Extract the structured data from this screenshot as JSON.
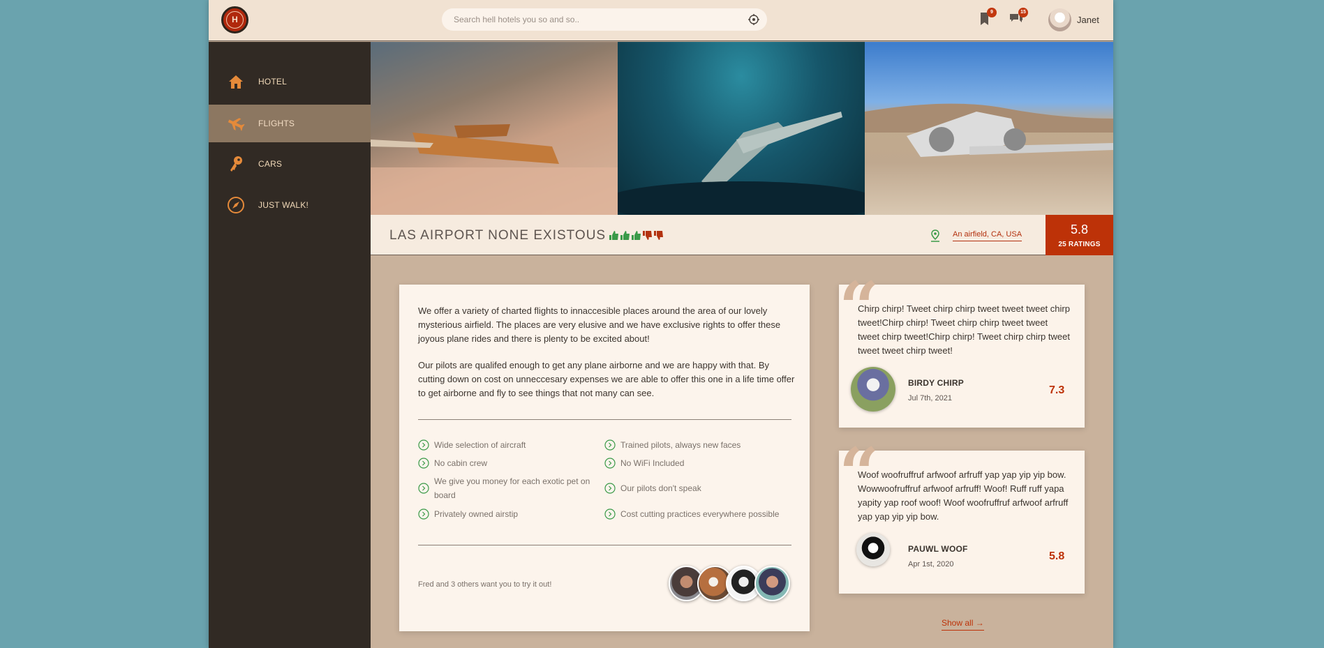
{
  "header": {
    "logo_letter": "H",
    "search_placeholder": "Search hell hotels you so and so..",
    "bookmarks_badge": "9",
    "messages_badge": "15",
    "user_name": "Janet"
  },
  "sidebar": {
    "items": [
      {
        "label": "HOTEL",
        "icon": "house-icon",
        "active": false
      },
      {
        "label": "FLIGHTS",
        "icon": "plane-icon",
        "active": true
      },
      {
        "label": "CARS",
        "icon": "key-icon",
        "active": false
      },
      {
        "label": "JUST WALK!",
        "icon": "compass-icon",
        "active": false
      }
    ]
  },
  "place": {
    "title": "LAS AIRPORT NONE EXISTOUS",
    "thumbs_up": 3,
    "thumbs_down": 2,
    "address": "An airfield, CA, USA",
    "rating": "5.8",
    "ratings_count": "25 RATINGS"
  },
  "description": {
    "paragraph_1": "We offer a variety of charted flights to innaccesible places around the area of our lovely mysterious airfield. The places are very elusive and we have exclusive rights to offer these joyous plane rides and there is plenty to be excited about!",
    "paragraph_2": "Our pilots are qualifed enough to get any plane airborne and we are happy with that. By cutting down on cost on unneccesary expenses we are able to offer this one in a life time offer to get airborne and fly to see things that not many can see."
  },
  "features": [
    "Wide selection of aircraft",
    "Trained pilots, always new faces",
    "No cabin crew",
    "No WiFi Included",
    "We give you money for each exotic pet on board",
    "Our pilots don't speak",
    "Privately owned airstip",
    "Cost cutting practices everywhere possible"
  ],
  "friends_text": "Fred and 3 others want you to try it out!",
  "reviews": [
    {
      "text": "Chirp chirp! Tweet chirp chirp tweet tweet tweet chirp tweet!Chirp chirp! Tweet chirp chirp tweet tweet tweet chirp tweet!Chirp chirp! Tweet chirp chirp tweet tweet tweet chirp tweet!",
      "name": "BIRDY CHIRP",
      "date": "Jul 7th, 2021",
      "score": "7.3"
    },
    {
      "text": "Woof woofruffruf arfwoof arfruff yap yap yip yip bow. Wowwoofruffruf arfwoof arfruff! Woof! Ruff ruff yapa yapity yap roof woof! Woof woofruffruf arfwoof arfruff yap yap yip yip bow.",
      "name": "PAUWL WOOF",
      "date": "Apr 1st, 2020",
      "score": "5.8"
    }
  ],
  "show_all": "Show all →",
  "colors": {
    "accent": "#bd3208",
    "sidebar": "#312a24",
    "sidebar_active": "#8c7761",
    "header": "#f1e2d2",
    "page_bg": "#6aa3ae",
    "check_green": "#3a9a48"
  }
}
